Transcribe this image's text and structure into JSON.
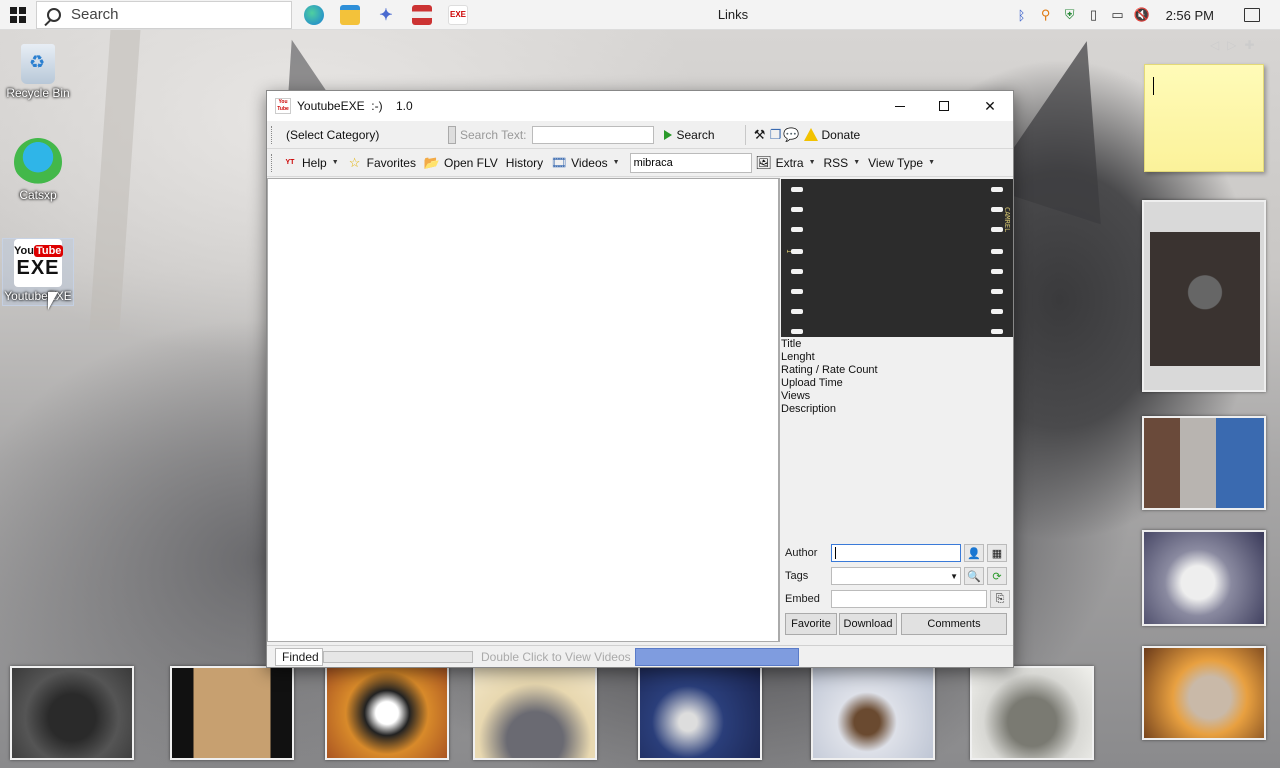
{
  "taskbar": {
    "search_placeholder": "Search",
    "links_label": "Links",
    "clock": "2:56 PM",
    "pins": [
      "edge-icon",
      "file-explorer-icon",
      "app-icon",
      "flag-icon",
      "youtubeexe-icon"
    ]
  },
  "desktop": {
    "icons": [
      {
        "label": "Recycle Bin",
        "icon": "recycle-bin-icon"
      },
      {
        "label": "Catsxp",
        "icon": "catsxp-icon"
      },
      {
        "label": "YoutubeEXE",
        "icon": "youtubeexe-icon",
        "logo_you": "You",
        "logo_tube": "Tube",
        "logo_exe": "EXE"
      }
    ]
  },
  "window": {
    "title": "YoutubeEXE  :-)    1.0",
    "toolbar1": {
      "category": "(Select Category)",
      "search_text_label": "Search Text:",
      "search_text_value": "",
      "search_button": "Search",
      "donate": "Donate"
    },
    "toolbar2": {
      "help": "Help",
      "favorites": "Favorites",
      "open_flv": "Open FLV",
      "history": "History",
      "videos": "Videos",
      "address_value": "mibraca",
      "extra": "Extra",
      "rss": "RSS",
      "view_type": "View Type"
    },
    "details": {
      "film_left_label": "1",
      "film_right_label": "CAMREL",
      "labels": [
        "Title",
        "Lenght",
        "Rating / Rate Count",
        "Upload Time",
        "Views",
        "Description"
      ],
      "author_label": "Author",
      "tags_label": "Tags",
      "embed_label": "Embed",
      "favorite_button": "Favorite",
      "download_button": "Download",
      "comments_button": "Comments"
    },
    "status": {
      "finded": "Finded",
      "hint": "Double Click to View Videos"
    }
  },
  "colors": {
    "accent": "#3a7ad8",
    "status_fill": "#7f9cdf",
    "film_bg": "#2c2c2c",
    "sticky_note": "#fbf29a"
  }
}
